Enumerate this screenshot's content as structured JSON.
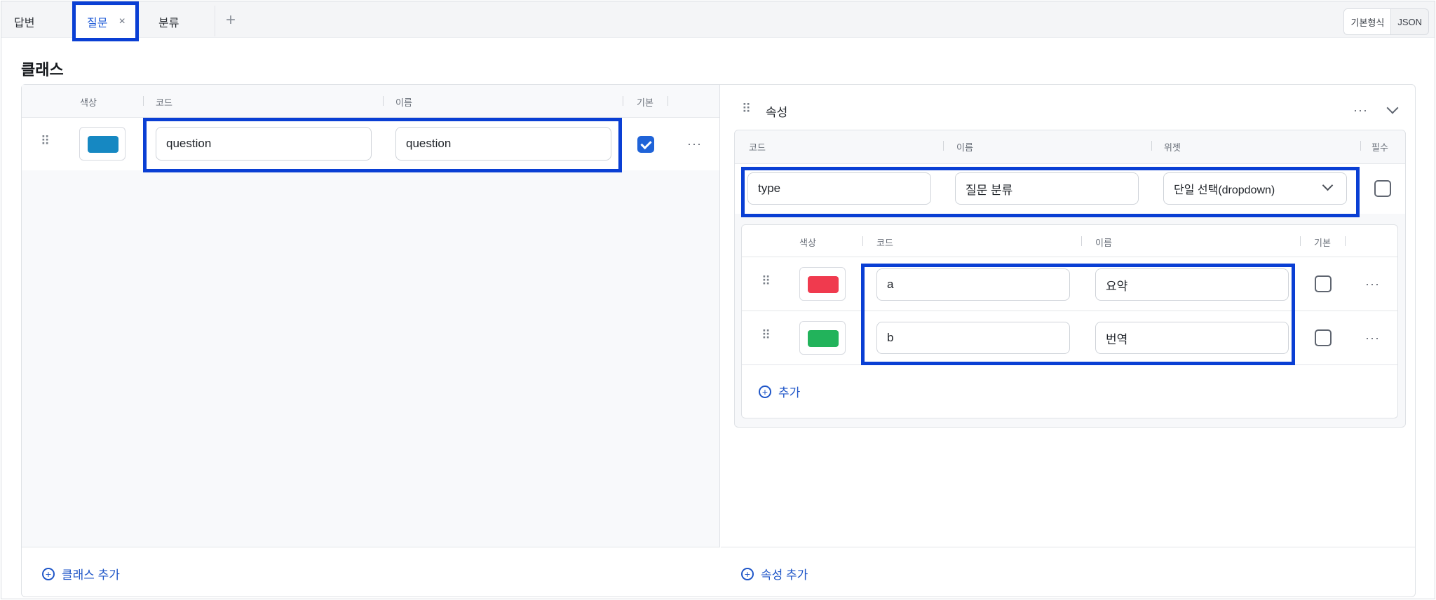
{
  "tabs": [
    {
      "label": "답변"
    },
    {
      "label": "질문",
      "close": "×"
    },
    {
      "label": "분류"
    }
  ],
  "tab_add": "+",
  "view_toggle": {
    "basic": "기본형식",
    "json": "JSON"
  },
  "section_title": "클래스",
  "class_table": {
    "headers": {
      "color": "색상",
      "code": "코드",
      "name": "이름",
      "default": "기본"
    },
    "rows": [
      {
        "color": "#1688c2",
        "code": "question",
        "name": "question",
        "default": true
      }
    ],
    "add_label": "클래스 추가"
  },
  "attributes": {
    "title": "속성",
    "headers": {
      "code": "코드",
      "name": "이름",
      "widget": "위젯",
      "required": "필수"
    },
    "item": {
      "code": "type",
      "name": "질문 분류",
      "widget": "단일 선택(dropdown)",
      "required": false
    },
    "options": {
      "headers": {
        "color": "색상",
        "code": "코드",
        "name": "이름",
        "default": "기본"
      },
      "rows": [
        {
          "color": "#f03a4e",
          "code": "a",
          "name": "요약",
          "default": false
        },
        {
          "color": "#22b35b",
          "code": "b",
          "name": "번역",
          "default": false
        }
      ],
      "add_label": "추가"
    },
    "add_label": "속성 추가"
  },
  "more_glyph": "···"
}
